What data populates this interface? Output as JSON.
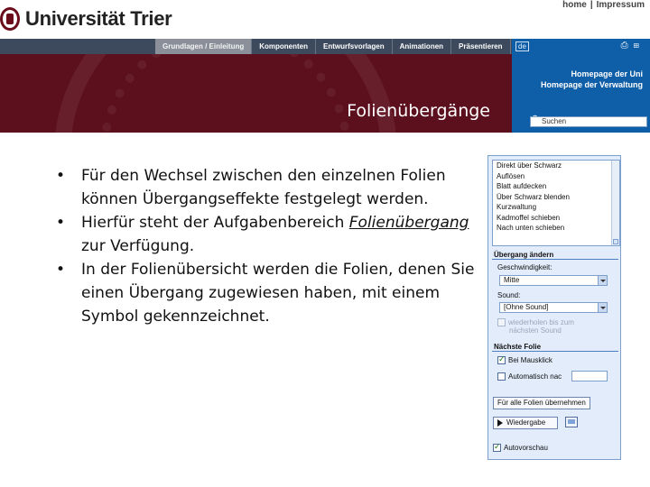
{
  "header": {
    "logo_text": "Universität Trier",
    "top_links": [
      "home",
      "|",
      "Impressum"
    ],
    "nav_tabs": [
      "Grundlagen / Einleitung",
      "Komponenten",
      "Entwurfsvorlagen",
      "Animationen",
      "Präsentieren"
    ],
    "active_tab_index": 0,
    "hero_title": "Folienübergänge"
  },
  "right_panel": {
    "language": "de",
    "links": [
      "Homepage der Uni",
      "Homepage der Verwaltung"
    ],
    "search_value": "Suchen"
  },
  "slide": {
    "bullets": [
      {
        "text": "Für den Wechsel zwischen den einzelnen Folien können Übergangseffekte festgelegt werden."
      },
      {
        "pre": "Hierfür steht der Aufgabenbereich ",
        "link": "Folienübergang",
        "post": " zur Verfügung."
      },
      {
        "text": "In der Folienübersicht werden die Folien, denen Sie einen Übergang zugewiesen haben, mit einem Symbol gekennzeichnet."
      }
    ]
  },
  "task_pane": {
    "transitions": [
      "Direkt über Schwarz",
      "Auflösen",
      "Blatt aufdecken",
      "Über Schwarz blenden",
      "Kurzwaltung",
      "Kadmoffel schieben",
      "Nach unten schieben"
    ],
    "section_change": "Übergang ändern",
    "speed_label": "Geschwindigkeit:",
    "speed_value": "Mitte",
    "sound_label": "Sound:",
    "sound_value": "[Ohne Sound]",
    "loop_label_1": "wiederholen bis zum",
    "loop_label_2": "nächsten Sound",
    "section_next": "Nächste Folie",
    "on_click_label": "Bei Mausklick",
    "auto_label": "Automatisch nac",
    "apply_all_button": "Für alle Folien übernehmen",
    "play_button": "Wiedergabe",
    "autopreview_label": "Autovorschau"
  }
}
